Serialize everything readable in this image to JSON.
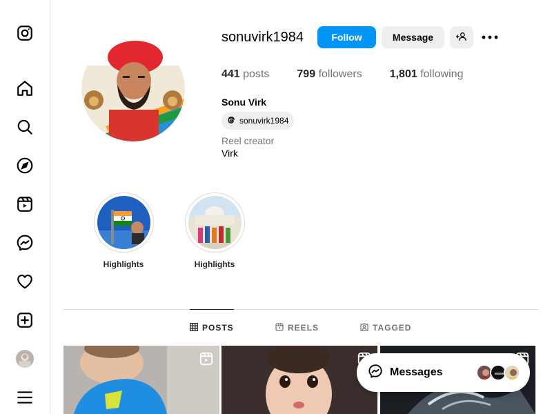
{
  "sidebar": {
    "items": [
      {
        "icon": "instagram-logo-icon"
      },
      {
        "icon": "home-icon"
      },
      {
        "icon": "search-icon"
      },
      {
        "icon": "explore-compass-icon"
      },
      {
        "icon": "reels-icon"
      },
      {
        "icon": "messenger-icon"
      },
      {
        "icon": "notifications-heart-icon"
      },
      {
        "icon": "create-plus-icon"
      },
      {
        "icon": "profile-avatar"
      },
      {
        "icon": "menu-hamburger-icon"
      }
    ]
  },
  "profile": {
    "username": "sonuvirk1984",
    "follow_label": "Follow",
    "message_label": "Message",
    "stats": {
      "posts_count": "441",
      "posts_label": "posts",
      "followers_count": "799",
      "followers_label": "followers",
      "following_count": "1,801",
      "following_label": "following"
    },
    "full_name": "Sonu Virk",
    "threads_handle": "sonuvirk1984",
    "category": "Reel creator",
    "bio": "Virk"
  },
  "highlights": [
    {
      "label": "Highlights"
    },
    {
      "label": "Highlights"
    }
  ],
  "tabs": [
    {
      "label": "POSTS",
      "icon": "grid-icon",
      "active": true
    },
    {
      "label": "REELS",
      "icon": "reels-icon",
      "active": false
    },
    {
      "label": "TAGGED",
      "icon": "tagged-icon",
      "active": false
    }
  ],
  "messages": {
    "label": "Messages"
  },
  "colors": {
    "accent": "#0095f6",
    "border": "#dbdbdb",
    "muted": "#737373"
  }
}
